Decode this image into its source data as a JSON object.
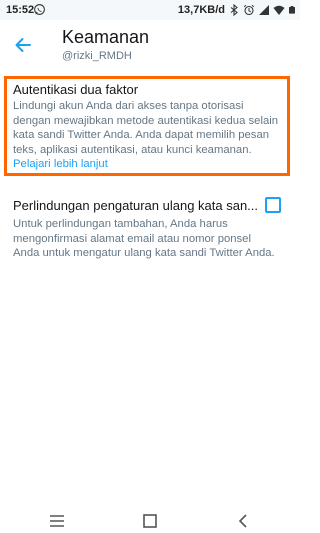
{
  "statusbar": {
    "time": "15:52",
    "network_speed": "13,7KB/d",
    "icons": [
      "whatsapp-icon",
      "bluetooth-icon",
      "alarm-icon",
      "signal-icon",
      "wifi-icon",
      "battery-icon"
    ]
  },
  "header": {
    "title": "Keamanan",
    "subtitle": "@rizki_RMDH",
    "back_icon": "arrow-left-icon"
  },
  "two_factor": {
    "title": "Autentikasi dua faktor",
    "description_lines": [
      "Lindungi akun Anda dari akses tanpa otorisasi",
      "dengan mewajibkan metode autentikasi kedua selain",
      "kata sandi Twitter Anda. Anda dapat memilih pesan",
      "teks, aplikasi autentikasi, atau kunci keamanan."
    ],
    "link": "Pelajari lebih lanjut"
  },
  "password_reset": {
    "title": "Perlindungan pengaturan ulang kata san...",
    "checked": false,
    "description_lines": [
      "Untuk perlindungan tambahan, Anda harus",
      "mengonfirmasi alamat email atau nomor ponsel",
      "Anda untuk mengatur ulang kata sandi Twitter Anda."
    ]
  },
  "navbar": {
    "icons": [
      "menu-icon",
      "home-icon",
      "back-icon"
    ]
  },
  "colors": {
    "accent": "#1da1f2",
    "highlight": "#ff6600",
    "text_primary": "#14171a",
    "text_secondary": "#657786"
  }
}
